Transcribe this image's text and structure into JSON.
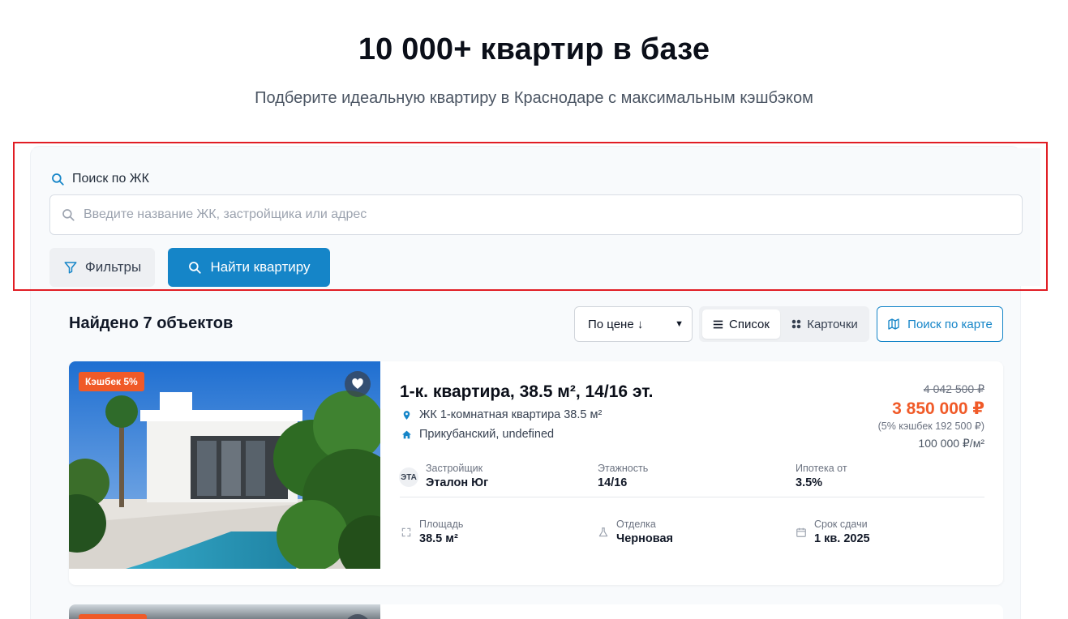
{
  "hero": {
    "title": "10 000+ квартир в базе",
    "subtitle": "Подберите идеальную квартиру в Краснодаре с максимальным кэшбэком"
  },
  "search": {
    "label": "Поиск по ЖК",
    "placeholder": "Введите название ЖК, застройщика или адрес",
    "value": "",
    "filters_label": "Фильтры",
    "find_label": "Найти квартиру"
  },
  "results": {
    "count_text": "Найдено 7 объектов",
    "sort_selected": "По цене ↓",
    "view_list_label": "Список",
    "view_cards_label": "Карточки",
    "active_view": "list",
    "map_label": "Поиск по карте"
  },
  "listings": [
    {
      "cashback_badge": "Кэшбек 5%",
      "title": "1-к. квартира, 38.5 м², 14/16 эт.",
      "complex": "ЖК 1-комнатная квартира 38.5 м²",
      "district": "Прикубанский, undefined",
      "old_price": "4 042 500 ₽",
      "price": "3 850 000 ₽",
      "cashback_note": "(5% кэшбек 192 500 ₽)",
      "price_per_m2": "100 000 ₽/м²",
      "developer_logo": "ЭТА",
      "developer_label": "Застройщик",
      "developer": "Эталон Юг",
      "floor_label": "Этажность",
      "floor": "14/16",
      "mortgage_label": "Ипотека от",
      "mortgage": "3.5%",
      "area_label": "Площадь",
      "area": "38.5 м²",
      "finish_label": "Отделка",
      "finish": "Черновая",
      "deadline_label": "Срок сдачи",
      "deadline": "1 кв. 2025",
      "favorite": true
    }
  ],
  "colors": {
    "accent": "#1585c8",
    "price": "#f05a28",
    "highlight_outline": "#e11d24"
  },
  "icons": {
    "search": "search-icon",
    "filter": "filter-icon",
    "list": "list-icon",
    "cards": "grid-icon",
    "map": "map-icon",
    "location": "location-pin-icon",
    "home": "home-icon",
    "heart": "heart-icon",
    "area": "expand-icon",
    "finish": "flask-icon",
    "calendar": "calendar-icon"
  }
}
